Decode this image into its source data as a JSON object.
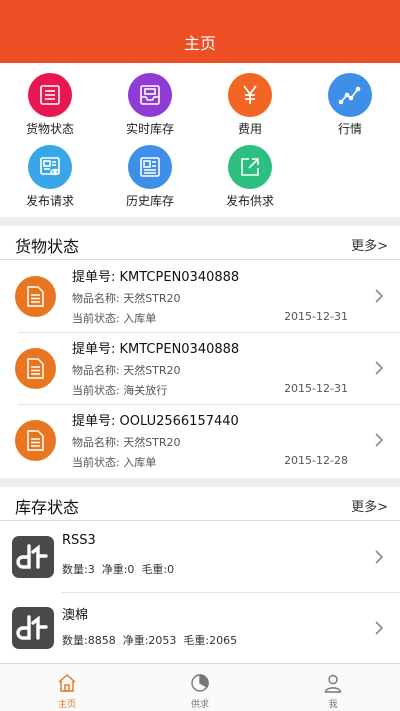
{
  "header": {
    "title": "主页"
  },
  "grid": {
    "items": [
      {
        "label": "货物状态",
        "icon": "list-icon",
        "color": "#e8174f"
      },
      {
        "label": "实时库存",
        "icon": "inbox-icon",
        "color": "#8e3bd8"
      },
      {
        "label": "费用",
        "icon": "yen-icon",
        "color": "#f26522"
      },
      {
        "label": "行情",
        "icon": "trend-icon",
        "color": "#3d8fe8"
      },
      {
        "label": "发布请求",
        "icon": "doc-eye-icon",
        "color": "#39a6e8"
      },
      {
        "label": "历史库存",
        "icon": "news-icon",
        "color": "#3d8fe8"
      },
      {
        "label": "发布供求",
        "icon": "share-icon",
        "color": "#2dbf80"
      }
    ]
  },
  "cargo": {
    "title": "货物状态",
    "more": "更多>",
    "rows": [
      {
        "bill": "提单号: KMTCPEN0340888",
        "product": "物品名称: 天然STR20",
        "status": "当前状态: 入库单",
        "date": "2015-12-31"
      },
      {
        "bill": "提单号: KMTCPEN0340888",
        "product": "物品名称: 天然STR20",
        "status": "当前状态: 海关放行",
        "date": "2015-12-31"
      },
      {
        "bill": "提单号: OOLU2566157440",
        "product": "物品名称: 天然STR20",
        "status": "当前状态: 入库单",
        "date": "2015-12-28"
      }
    ]
  },
  "inventory": {
    "title": "库存状态",
    "more": "更多>",
    "rows": [
      {
        "name": "RSS3",
        "qty": "数量:3",
        "net": "净重:0",
        "gross": "毛重:0"
      },
      {
        "name": "澳棉",
        "qty": "数量:8858",
        "net": "净重:2053",
        "gross": "毛重:2065"
      }
    ]
  },
  "tabs": [
    {
      "label": "主页",
      "icon": "home-icon",
      "active": true
    },
    {
      "label": "供求",
      "icon": "pie-chart-icon",
      "active": false
    },
    {
      "label": "我",
      "icon": "user-icon",
      "active": false
    }
  ],
  "colors": {
    "header": "#ee4e23",
    "accent": "#e8751f"
  }
}
